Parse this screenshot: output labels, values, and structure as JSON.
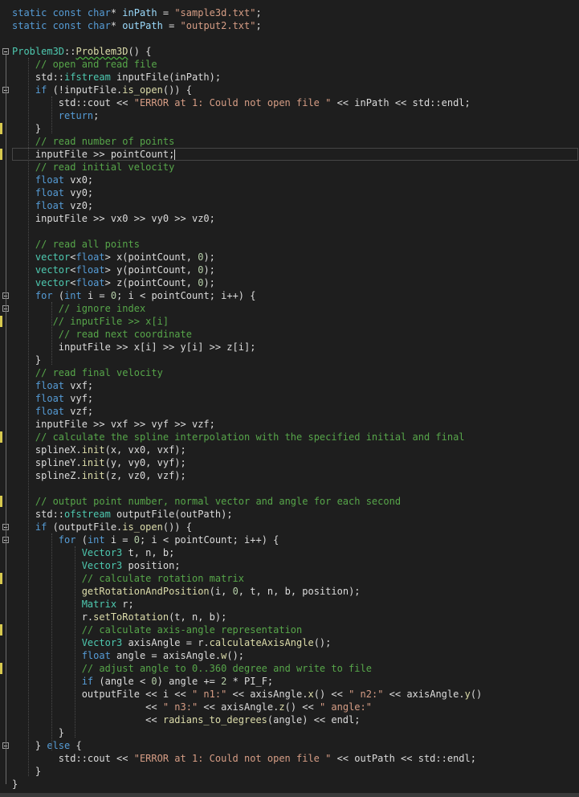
{
  "colors": {
    "background": "#1e1e1e",
    "keyword": "#569cd6",
    "string": "#d69d85",
    "comment": "#57a64a",
    "number": "#b5cea8",
    "function": "#dcdcaa",
    "type": "#4ec9b0",
    "plain": "#dcdcdc",
    "changed_marker": "#d7c94f"
  },
  "icons": {
    "fold": "collapse-minus-icon"
  },
  "editor": {
    "current_line": 11,
    "lines": [
      [
        [
          "kw",
          "static const char"
        ],
        [
          "pl",
          "* "
        ],
        [
          "var",
          "inPath"
        ],
        [
          "pl",
          " = "
        ],
        [
          "str",
          "\"sample3d.txt\""
        ],
        [
          "pl",
          ";"
        ]
      ],
      [
        [
          "kw",
          "static const char"
        ],
        [
          "pl",
          "* "
        ],
        [
          "var",
          "outPath"
        ],
        [
          "pl",
          " = "
        ],
        [
          "str",
          "\"output2.txt\""
        ],
        [
          "pl",
          ";"
        ]
      ],
      [],
      [
        [
          "ty",
          "Problem3D"
        ],
        [
          "pl",
          "::"
        ],
        [
          "fn",
          "Problem3D"
        ],
        [
          "pl",
          "() {"
        ]
      ],
      [
        [
          "pl",
          "    "
        ],
        [
          "cm",
          "// open and read file"
        ]
      ],
      [
        [
          "pl",
          "    std::"
        ],
        [
          "ty",
          "ifstream"
        ],
        [
          "pl",
          " inputFile(inPath);"
        ]
      ],
      [
        [
          "pl",
          "    "
        ],
        [
          "kw",
          "if"
        ],
        [
          "pl",
          " (!inputFile."
        ],
        [
          "fn",
          "is_open"
        ],
        [
          "pl",
          "()) {"
        ]
      ],
      [
        [
          "pl",
          "        std::cout << "
        ],
        [
          "str",
          "\"ERROR at 1: Could not open file \""
        ],
        [
          "pl",
          " << inPath << std::endl;"
        ]
      ],
      [
        [
          "pl",
          "        "
        ],
        [
          "kw",
          "return"
        ],
        [
          "pl",
          ";"
        ]
      ],
      [
        [
          "pl",
          "    }"
        ]
      ],
      [
        [
          "pl",
          "    "
        ],
        [
          "cm",
          "// read number of points"
        ]
      ],
      [
        [
          "pl",
          "    inputFile >> pointCount;"
        ]
      ],
      [
        [
          "pl",
          "    "
        ],
        [
          "cm",
          "// read initial velocity"
        ]
      ],
      [
        [
          "pl",
          "    "
        ],
        [
          "kw",
          "float"
        ],
        [
          "pl",
          " vx0;"
        ]
      ],
      [
        [
          "pl",
          "    "
        ],
        [
          "kw",
          "float"
        ],
        [
          "pl",
          " vy0;"
        ]
      ],
      [
        [
          "pl",
          "    "
        ],
        [
          "kw",
          "float"
        ],
        [
          "pl",
          " vz0;"
        ]
      ],
      [
        [
          "pl",
          "    inputFile >> vx0 >> vy0 >> vz0;"
        ]
      ],
      [],
      [
        [
          "pl",
          "    "
        ],
        [
          "cm",
          "// read all points"
        ]
      ],
      [
        [
          "pl",
          "    "
        ],
        [
          "ty",
          "vector"
        ],
        [
          "pl",
          "<"
        ],
        [
          "kw",
          "float"
        ],
        [
          "pl",
          "> x(pointCount, "
        ],
        [
          "num",
          "0"
        ],
        [
          "pl",
          ");"
        ]
      ],
      [
        [
          "pl",
          "    "
        ],
        [
          "ty",
          "vector"
        ],
        [
          "pl",
          "<"
        ],
        [
          "kw",
          "float"
        ],
        [
          "pl",
          "> y(pointCount, "
        ],
        [
          "num",
          "0"
        ],
        [
          "pl",
          ");"
        ]
      ],
      [
        [
          "pl",
          "    "
        ],
        [
          "ty",
          "vector"
        ],
        [
          "pl",
          "<"
        ],
        [
          "kw",
          "float"
        ],
        [
          "pl",
          "> z(pointCount, "
        ],
        [
          "num",
          "0"
        ],
        [
          "pl",
          ");"
        ]
      ],
      [
        [
          "pl",
          "    "
        ],
        [
          "kw",
          "for"
        ],
        [
          "pl",
          " ("
        ],
        [
          "kw",
          "int"
        ],
        [
          "pl",
          " i = "
        ],
        [
          "num",
          "0"
        ],
        [
          "pl",
          "; i < pointCount; i++) {"
        ]
      ],
      [
        [
          "pl",
          "        "
        ],
        [
          "cm",
          "// ignore index"
        ]
      ],
      [
        [
          "pl",
          "       "
        ],
        [
          "cm",
          "// inputFile >> x[i]"
        ]
      ],
      [
        [
          "pl",
          "        "
        ],
        [
          "cm",
          "// read next coordinate"
        ]
      ],
      [
        [
          "pl",
          "        inputFile >> x[i] >> y[i] >> z[i];"
        ]
      ],
      [
        [
          "pl",
          "    }"
        ]
      ],
      [
        [
          "pl",
          "    "
        ],
        [
          "cm",
          "// read final velocity"
        ]
      ],
      [
        [
          "pl",
          "    "
        ],
        [
          "kw",
          "float"
        ],
        [
          "pl",
          " vxf;"
        ]
      ],
      [
        [
          "pl",
          "    "
        ],
        [
          "kw",
          "float"
        ],
        [
          "pl",
          " vyf;"
        ]
      ],
      [
        [
          "pl",
          "    "
        ],
        [
          "kw",
          "float"
        ],
        [
          "pl",
          " vzf;"
        ]
      ],
      [
        [
          "pl",
          "    inputFile >> vxf >> vyf >> vzf;"
        ]
      ],
      [
        [
          "pl",
          "    "
        ],
        [
          "cm",
          "// calculate the spline interpolation with the specified initial and final"
        ]
      ],
      [
        [
          "pl",
          "    splineX."
        ],
        [
          "fn",
          "init"
        ],
        [
          "pl",
          "(x, vx0, vxf);"
        ]
      ],
      [
        [
          "pl",
          "    splineY."
        ],
        [
          "fn",
          "init"
        ],
        [
          "pl",
          "(y, vy0, vyf);"
        ]
      ],
      [
        [
          "pl",
          "    splineZ."
        ],
        [
          "fn",
          "init"
        ],
        [
          "pl",
          "(z, vz0, vzf);"
        ]
      ],
      [],
      [
        [
          "pl",
          "    "
        ],
        [
          "cm",
          "// output point number, normal vector and angle for each second"
        ]
      ],
      [
        [
          "pl",
          "    std::"
        ],
        [
          "ty",
          "ofstream"
        ],
        [
          "pl",
          " outputFile(outPath);"
        ]
      ],
      [
        [
          "pl",
          "    "
        ],
        [
          "kw",
          "if"
        ],
        [
          "pl",
          " (outputFile."
        ],
        [
          "fn",
          "is_open"
        ],
        [
          "pl",
          "()) {"
        ]
      ],
      [
        [
          "pl",
          "        "
        ],
        [
          "kw",
          "for"
        ],
        [
          "pl",
          " ("
        ],
        [
          "kw",
          "int"
        ],
        [
          "pl",
          " i = "
        ],
        [
          "num",
          "0"
        ],
        [
          "pl",
          "; i < pointCount; i++) {"
        ]
      ],
      [
        [
          "pl",
          "            "
        ],
        [
          "ty",
          "Vector3"
        ],
        [
          "pl",
          " t, n, b;"
        ]
      ],
      [
        [
          "pl",
          "            "
        ],
        [
          "ty",
          "Vector3"
        ],
        [
          "pl",
          " position;"
        ]
      ],
      [
        [
          "pl",
          "            "
        ],
        [
          "cm",
          "// calculate rotation matrix"
        ]
      ],
      [
        [
          "pl",
          "            "
        ],
        [
          "fn",
          "getRotationAndPosition"
        ],
        [
          "pl",
          "(i, "
        ],
        [
          "num",
          "0"
        ],
        [
          "pl",
          ", t, n, b, position);"
        ]
      ],
      [
        [
          "pl",
          "            "
        ],
        [
          "ty",
          "Matrix"
        ],
        [
          "pl",
          " r;"
        ]
      ],
      [
        [
          "pl",
          "            r."
        ],
        [
          "fn",
          "setToRotation"
        ],
        [
          "pl",
          "(t, n, b);"
        ]
      ],
      [
        [
          "pl",
          "            "
        ],
        [
          "cm",
          "// calculate axis-angle representation"
        ]
      ],
      [
        [
          "pl",
          "            "
        ],
        [
          "ty",
          "Vector3"
        ],
        [
          "pl",
          " axisAngle = r."
        ],
        [
          "fn",
          "calculateAxisAngle"
        ],
        [
          "pl",
          "();"
        ]
      ],
      [
        [
          "pl",
          "            "
        ],
        [
          "kw",
          "float"
        ],
        [
          "pl",
          " angle = axisAngle."
        ],
        [
          "fn",
          "w"
        ],
        [
          "pl",
          "();"
        ]
      ],
      [
        [
          "pl",
          "            "
        ],
        [
          "cm",
          "// adjust angle to 0..360 degree and write to file"
        ]
      ],
      [
        [
          "pl",
          "            "
        ],
        [
          "kw",
          "if"
        ],
        [
          "pl",
          " (angle < "
        ],
        [
          "num",
          "0"
        ],
        [
          "pl",
          ") angle += "
        ],
        [
          "num",
          "2"
        ],
        [
          "pl",
          " * PI_F;"
        ]
      ],
      [
        [
          "pl",
          "            outputFile << i << "
        ],
        [
          "str",
          "\" n1:\""
        ],
        [
          "pl",
          " << axisAngle."
        ],
        [
          "fn",
          "x"
        ],
        [
          "pl",
          "() << "
        ],
        [
          "str",
          "\" n2:\""
        ],
        [
          "pl",
          " << axisAngle."
        ],
        [
          "fn",
          "y"
        ],
        [
          "pl",
          "()"
        ]
      ],
      [
        [
          "pl",
          "                       << "
        ],
        [
          "str",
          "\" n3:\""
        ],
        [
          "pl",
          " << axisAngle."
        ],
        [
          "fn",
          "z"
        ],
        [
          "pl",
          "() << "
        ],
        [
          "str",
          "\" angle:\""
        ]
      ],
      [
        [
          "pl",
          "                       << "
        ],
        [
          "fn",
          "radians_to_degrees"
        ],
        [
          "pl",
          "(angle) << endl;"
        ]
      ],
      [
        [
          "pl",
          "        }"
        ]
      ],
      [
        [
          "pl",
          "    } "
        ],
        [
          "kw",
          "else"
        ],
        [
          "pl",
          " {"
        ]
      ],
      [
        [
          "pl",
          "        std::cout << "
        ],
        [
          "str",
          "\"ERROR at 1: Could not open file \""
        ],
        [
          "pl",
          " << outPath << std::endl;"
        ]
      ],
      [
        [
          "pl",
          "    }"
        ]
      ],
      [
        [
          "pl",
          "}"
        ]
      ]
    ]
  }
}
